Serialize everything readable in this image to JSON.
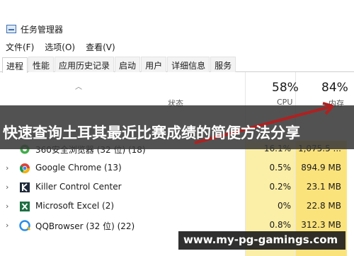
{
  "window": {
    "title": "任务管理器"
  },
  "menu": [
    "文件(F)",
    "选项(O)",
    "查看(V)"
  ],
  "tabs": [
    "进程",
    "性能",
    "应用历史记录",
    "启动",
    "用户",
    "详细信息",
    "服务"
  ],
  "header": {
    "status_label": "状态",
    "cpu_pct": "58%",
    "cpu_label": "CPU",
    "mem_pct": "84%",
    "mem_label": "内存"
  },
  "banner": {
    "text": "快速查询土耳其最近比赛成绩的简便方法分享"
  },
  "rows": [
    {
      "name": "360安全浏览器 (32 位) (18)",
      "cpu": "16.1%",
      "mem": "1,075.5 ..."
    },
    {
      "name": "Google Chrome (13)",
      "cpu": "0.5%",
      "mem": "894.9 MB"
    },
    {
      "name": "Killer Control Center",
      "cpu": "0.2%",
      "mem": "23.1 MB"
    },
    {
      "name": "Microsoft Excel (2)",
      "cpu": "0%",
      "mem": "22.8 MB"
    },
    {
      "name": "QQBrowser (32 位) (22)",
      "cpu": "0.8%",
      "mem": "312.3 MB"
    }
  ],
  "watermark": {
    "text": "www.my-pg-gamings.com"
  },
  "colors": {
    "cpu_heat": "#fbeea6",
    "mem_heat": "#fbe37c",
    "banner_bg": "#3a3a3a",
    "arrow": "#b02020"
  }
}
